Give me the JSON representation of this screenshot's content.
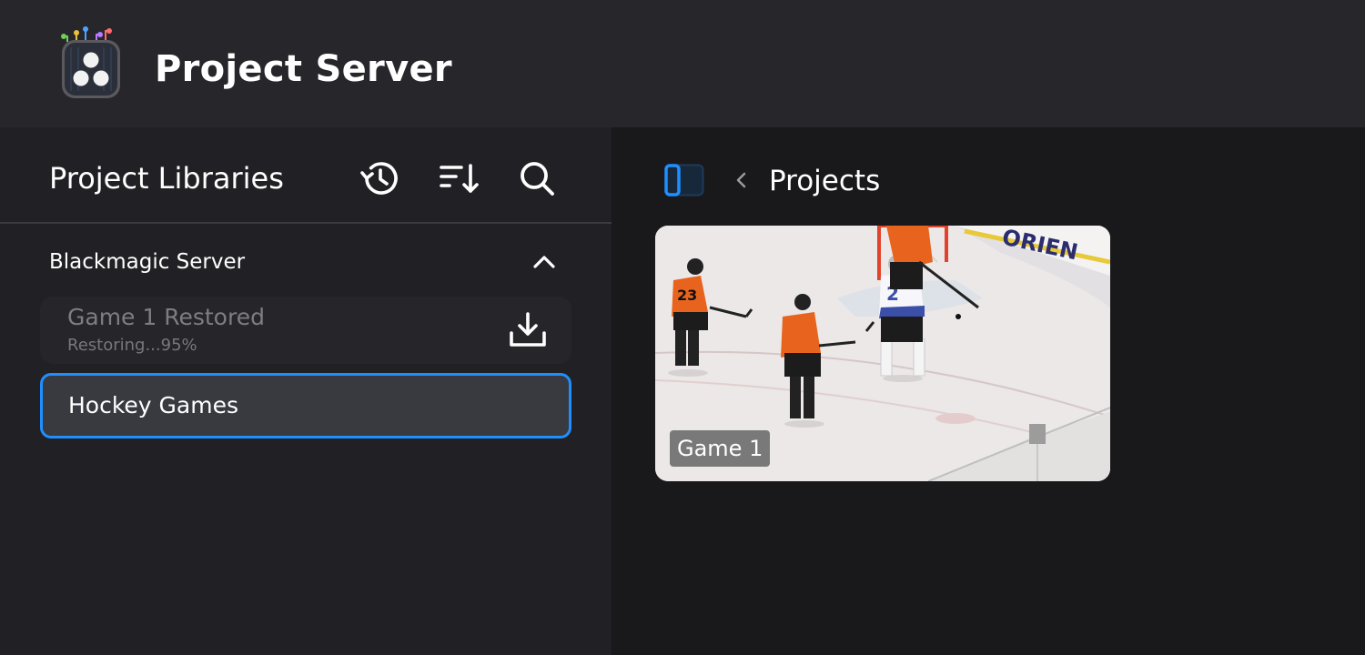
{
  "app": {
    "title": "Project Server",
    "icon": "davinci-resolve-logo"
  },
  "sidebar": {
    "title": "Project Libraries",
    "toolbar": {
      "history_icon": "history-icon",
      "sort_icon": "sort-descending-icon",
      "search_icon": "search-icon"
    },
    "group": {
      "label": "Blackmagic Server",
      "expanded": true,
      "icon": "chevron-up-icon"
    },
    "libraries": [
      {
        "name": "Game 1 Restored",
        "status": "Restoring...95%",
        "progress": 0.95,
        "icon": "download-icon"
      },
      {
        "name": "Hockey Games",
        "selected": true
      }
    ]
  },
  "main": {
    "panel_toggle_icon": "sidebar-toggle-icon",
    "back_icon": "chevron-left-icon",
    "title": "Projects",
    "projects": [
      {
        "name": "Game 1",
        "thumbnail": "hockey-game-thumbnail"
      }
    ]
  },
  "colors": {
    "accent": "#1f8fff",
    "header_bg": "#27272b",
    "sidebar_bg": "#212125",
    "main_bg": "#19191c",
    "player_orange": "#e8641e"
  }
}
